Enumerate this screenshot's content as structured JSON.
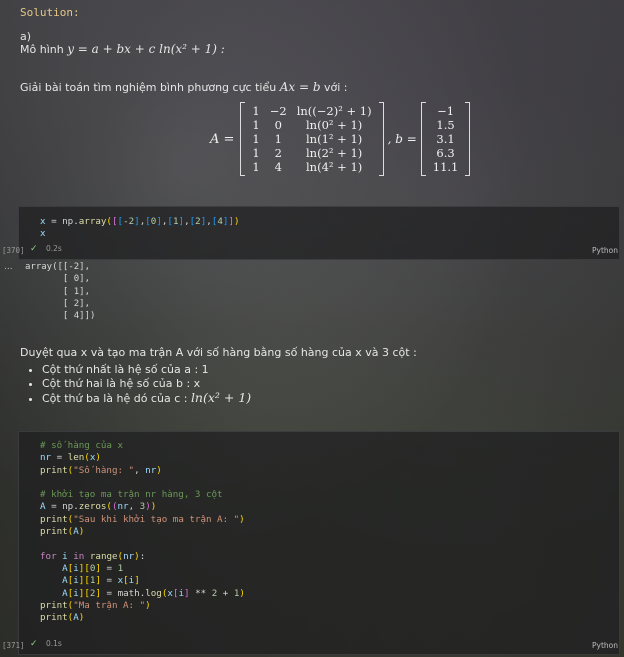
{
  "solution_label": "Solution:",
  "part_label": "a)",
  "model": {
    "text": "Mô hình ",
    "formula": "y = a + bx + c ln(x² + 1) :"
  },
  "intro": {
    "text": "Giải bài toán tìm nghiệm bình phương cực tiểu ",
    "formula": "Ax = b",
    "suffix": " với :"
  },
  "equation": {
    "a_label": "A =",
    "b_label": ", b =",
    "A_rows": [
      [
        "1",
        "−2",
        "ln((−2)² + 1)"
      ],
      [
        "1",
        "0",
        "ln(0² + 1)"
      ],
      [
        "1",
        "1",
        "ln(1² + 1)"
      ],
      [
        "1",
        "2",
        "ln(2² + 1)"
      ],
      [
        "1",
        "4",
        "ln(4² + 1)"
      ]
    ],
    "b_values": [
      "−1",
      "1.5",
      "3.1",
      "6.3",
      "11.1"
    ]
  },
  "cell1": {
    "exec_count": "[370]",
    "exec_time": "0.2s",
    "language": "Python"
  },
  "output1": {
    "dots": "...",
    "text": "array([[-2],\n       [ 0],\n       [ 1],\n       [ 2],\n       [ 4]])"
  },
  "para": "Duyệt qua x và tạo ma trận A với số hàng bằng số hàng của x và 3 cột :",
  "bullets": [
    "Cột thứ nhất là hệ số của a : 1",
    "Cột thứ hai là hệ số của b : x",
    "Cột thứ ba là hệ dó của c : "
  ],
  "bullet3_formula": "ln(x² + 1)",
  "cell2": {
    "exec_count": "[371]",
    "exec_time": "0.1s",
    "language": "Python"
  }
}
